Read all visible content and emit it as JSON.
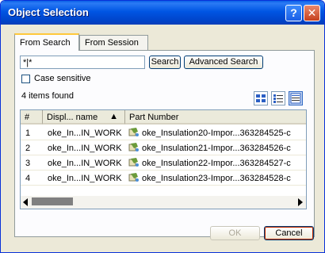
{
  "window": {
    "title": "Object Selection"
  },
  "titlebar": {
    "help_label": "?",
    "close_label": "✕"
  },
  "tabs": [
    {
      "label": "From Search",
      "active": true
    },
    {
      "label": "From Session",
      "active": false
    }
  ],
  "search": {
    "value": "*|*",
    "search_label": "Search",
    "advanced_label": "Advanced Search",
    "case_label": "Case sensitive",
    "case_checked": false
  },
  "results": {
    "count_text": "4 items found"
  },
  "views": {
    "icons": [
      "view-large-icons-icon",
      "view-small-icons-icon",
      "view-details-icon"
    ],
    "selected": "view-details-icon"
  },
  "table": {
    "columns": [
      "#",
      "Displ... name",
      "Part Number"
    ],
    "sort_indicator": "▲",
    "rows": [
      {
        "num": "1",
        "name": "oke_In...IN_WORK",
        "part": "oke_Insulation20-Impor...363284525-c"
      },
      {
        "num": "2",
        "name": "oke_In...IN_WORK",
        "part": "oke_Insulation21-Impor...363284526-c"
      },
      {
        "num": "3",
        "name": "oke_In...IN_WORK",
        "part": "oke_Insulation22-Impor...363284527-c"
      },
      {
        "num": "4",
        "name": "oke_In...IN_WORK",
        "part": "oke_Insulation23-Impor...363284528-c"
      }
    ]
  },
  "footer": {
    "ok_label": "OK",
    "cancel_label": "Cancel"
  },
  "colors": {
    "title_bar": "#0055e3",
    "dialog_bg": "#ece9d8",
    "cancel_focus": "#c22a00"
  }
}
